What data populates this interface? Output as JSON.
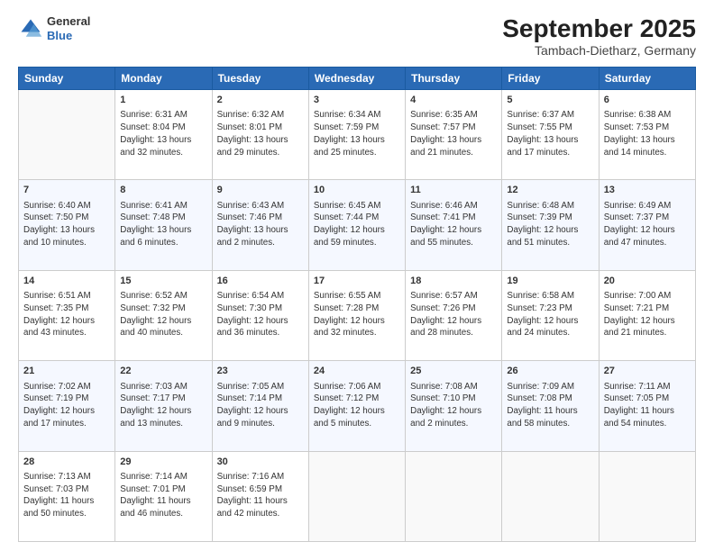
{
  "header": {
    "logo_line1": "General",
    "logo_line2": "Blue",
    "title": "September 2025",
    "subtitle": "Tambach-Dietharz, Germany"
  },
  "days_of_week": [
    "Sunday",
    "Monday",
    "Tuesday",
    "Wednesday",
    "Thursday",
    "Friday",
    "Saturday"
  ],
  "weeks": [
    [
      {
        "day": "",
        "info": ""
      },
      {
        "day": "1",
        "info": "Sunrise: 6:31 AM\nSunset: 8:04 PM\nDaylight: 13 hours\nand 32 minutes."
      },
      {
        "day": "2",
        "info": "Sunrise: 6:32 AM\nSunset: 8:01 PM\nDaylight: 13 hours\nand 29 minutes."
      },
      {
        "day": "3",
        "info": "Sunrise: 6:34 AM\nSunset: 7:59 PM\nDaylight: 13 hours\nand 25 minutes."
      },
      {
        "day": "4",
        "info": "Sunrise: 6:35 AM\nSunset: 7:57 PM\nDaylight: 13 hours\nand 21 minutes."
      },
      {
        "day": "5",
        "info": "Sunrise: 6:37 AM\nSunset: 7:55 PM\nDaylight: 13 hours\nand 17 minutes."
      },
      {
        "day": "6",
        "info": "Sunrise: 6:38 AM\nSunset: 7:53 PM\nDaylight: 13 hours\nand 14 minutes."
      }
    ],
    [
      {
        "day": "7",
        "info": "Sunrise: 6:40 AM\nSunset: 7:50 PM\nDaylight: 13 hours\nand 10 minutes."
      },
      {
        "day": "8",
        "info": "Sunrise: 6:41 AM\nSunset: 7:48 PM\nDaylight: 13 hours\nand 6 minutes."
      },
      {
        "day": "9",
        "info": "Sunrise: 6:43 AM\nSunset: 7:46 PM\nDaylight: 13 hours\nand 2 minutes."
      },
      {
        "day": "10",
        "info": "Sunrise: 6:45 AM\nSunset: 7:44 PM\nDaylight: 12 hours\nand 59 minutes."
      },
      {
        "day": "11",
        "info": "Sunrise: 6:46 AM\nSunset: 7:41 PM\nDaylight: 12 hours\nand 55 minutes."
      },
      {
        "day": "12",
        "info": "Sunrise: 6:48 AM\nSunset: 7:39 PM\nDaylight: 12 hours\nand 51 minutes."
      },
      {
        "day": "13",
        "info": "Sunrise: 6:49 AM\nSunset: 7:37 PM\nDaylight: 12 hours\nand 47 minutes."
      }
    ],
    [
      {
        "day": "14",
        "info": "Sunrise: 6:51 AM\nSunset: 7:35 PM\nDaylight: 12 hours\nand 43 minutes."
      },
      {
        "day": "15",
        "info": "Sunrise: 6:52 AM\nSunset: 7:32 PM\nDaylight: 12 hours\nand 40 minutes."
      },
      {
        "day": "16",
        "info": "Sunrise: 6:54 AM\nSunset: 7:30 PM\nDaylight: 12 hours\nand 36 minutes."
      },
      {
        "day": "17",
        "info": "Sunrise: 6:55 AM\nSunset: 7:28 PM\nDaylight: 12 hours\nand 32 minutes."
      },
      {
        "day": "18",
        "info": "Sunrise: 6:57 AM\nSunset: 7:26 PM\nDaylight: 12 hours\nand 28 minutes."
      },
      {
        "day": "19",
        "info": "Sunrise: 6:58 AM\nSunset: 7:23 PM\nDaylight: 12 hours\nand 24 minutes."
      },
      {
        "day": "20",
        "info": "Sunrise: 7:00 AM\nSunset: 7:21 PM\nDaylight: 12 hours\nand 21 minutes."
      }
    ],
    [
      {
        "day": "21",
        "info": "Sunrise: 7:02 AM\nSunset: 7:19 PM\nDaylight: 12 hours\nand 17 minutes."
      },
      {
        "day": "22",
        "info": "Sunrise: 7:03 AM\nSunset: 7:17 PM\nDaylight: 12 hours\nand 13 minutes."
      },
      {
        "day": "23",
        "info": "Sunrise: 7:05 AM\nSunset: 7:14 PM\nDaylight: 12 hours\nand 9 minutes."
      },
      {
        "day": "24",
        "info": "Sunrise: 7:06 AM\nSunset: 7:12 PM\nDaylight: 12 hours\nand 5 minutes."
      },
      {
        "day": "25",
        "info": "Sunrise: 7:08 AM\nSunset: 7:10 PM\nDaylight: 12 hours\nand 2 minutes."
      },
      {
        "day": "26",
        "info": "Sunrise: 7:09 AM\nSunset: 7:08 PM\nDaylight: 11 hours\nand 58 minutes."
      },
      {
        "day": "27",
        "info": "Sunrise: 7:11 AM\nSunset: 7:05 PM\nDaylight: 11 hours\nand 54 minutes."
      }
    ],
    [
      {
        "day": "28",
        "info": "Sunrise: 7:13 AM\nSunset: 7:03 PM\nDaylight: 11 hours\nand 50 minutes."
      },
      {
        "day": "29",
        "info": "Sunrise: 7:14 AM\nSunset: 7:01 PM\nDaylight: 11 hours\nand 46 minutes."
      },
      {
        "day": "30",
        "info": "Sunrise: 7:16 AM\nSunset: 6:59 PM\nDaylight: 11 hours\nand 42 minutes."
      },
      {
        "day": "",
        "info": ""
      },
      {
        "day": "",
        "info": ""
      },
      {
        "day": "",
        "info": ""
      },
      {
        "day": "",
        "info": ""
      }
    ]
  ]
}
